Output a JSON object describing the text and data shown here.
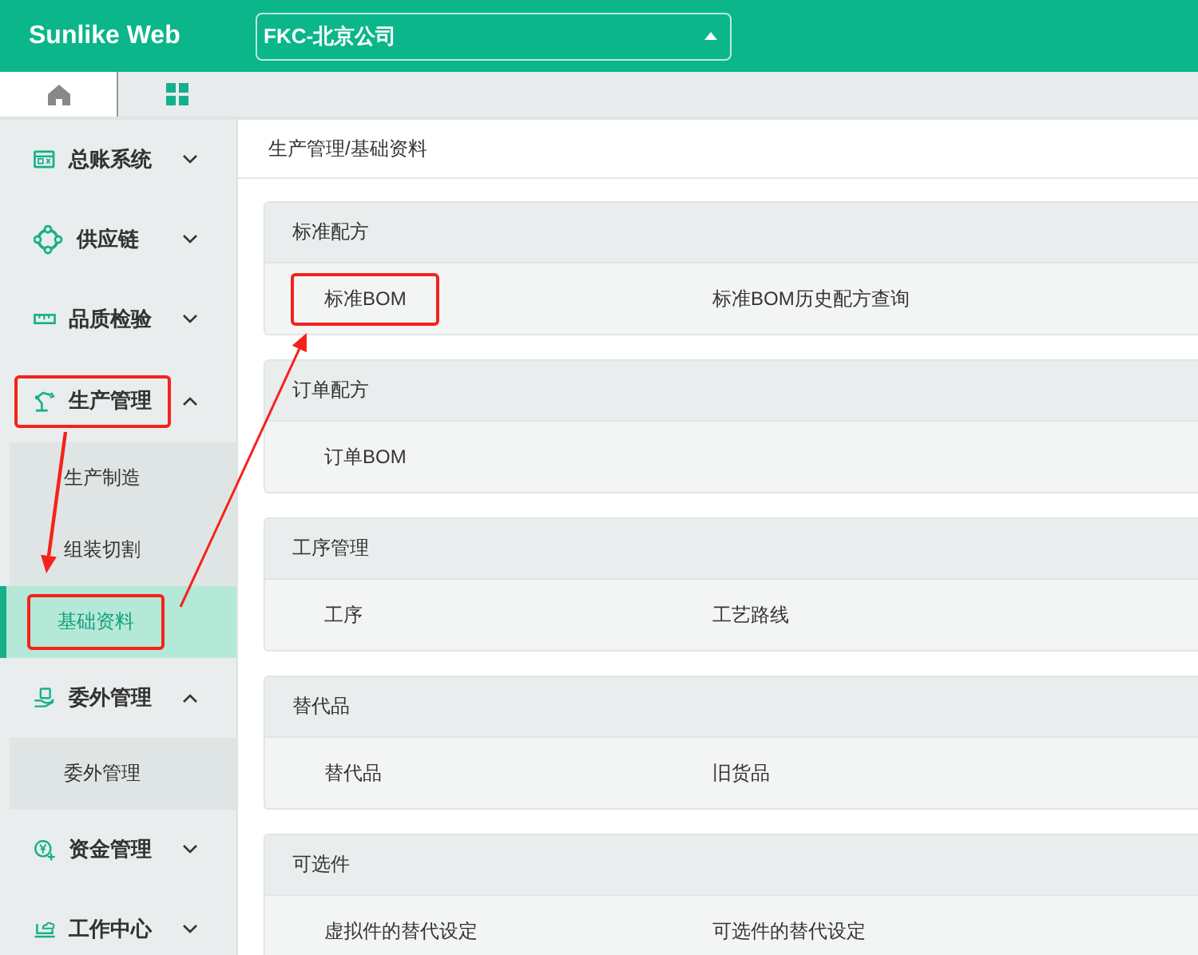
{
  "app": {
    "title": "Sunlike Web"
  },
  "company_select": {
    "value": "FKC-北京公司"
  },
  "tabs": [
    {
      "selected": true
    },
    {
      "selected": false
    }
  ],
  "sidebar": {
    "items": [
      {
        "label": "总账系统",
        "expanded": false,
        "highlighted": false
      },
      {
        "label": "供应链",
        "expanded": false,
        "highlighted": false
      },
      {
        "label": "品质检验",
        "expanded": false,
        "highlighted": false
      },
      {
        "label": "生产管理",
        "expanded": true,
        "highlighted": true,
        "children": [
          {
            "label": "生产制造",
            "selected": false,
            "highlighted": false
          },
          {
            "label": "组装切割",
            "selected": false,
            "highlighted": false
          },
          {
            "label": "基础资料",
            "selected": true,
            "highlighted": true
          }
        ]
      },
      {
        "label": "委外管理",
        "expanded": true,
        "highlighted": false,
        "children": [
          {
            "label": "委外管理",
            "selected": false,
            "highlighted": false
          }
        ]
      },
      {
        "label": "资金管理",
        "expanded": false,
        "highlighted": false
      },
      {
        "label": "工作中心",
        "expanded": false,
        "highlighted": false
      }
    ]
  },
  "breadcrumb": "生产管理/基础资料",
  "sections": [
    {
      "title": "标准配方",
      "items": [
        {
          "label": "标准BOM",
          "highlighted": true
        },
        {
          "label": "标准BOM历史配方查询",
          "highlighted": false
        }
      ]
    },
    {
      "title": "订单配方",
      "items": [
        {
          "label": "订单BOM",
          "highlighted": false
        }
      ]
    },
    {
      "title": "工序管理",
      "items": [
        {
          "label": "工序",
          "highlighted": false
        },
        {
          "label": "工艺路线",
          "highlighted": false
        }
      ]
    },
    {
      "title": "替代品",
      "items": [
        {
          "label": "替代品",
          "highlighted": false
        },
        {
          "label": "旧货品",
          "highlighted": false
        }
      ]
    },
    {
      "title": "可选件",
      "items": [
        {
          "label": "虚拟件的替代设定",
          "highlighted": false
        },
        {
          "label": "可选件的替代设定",
          "highlighted": false
        }
      ]
    }
  ]
}
